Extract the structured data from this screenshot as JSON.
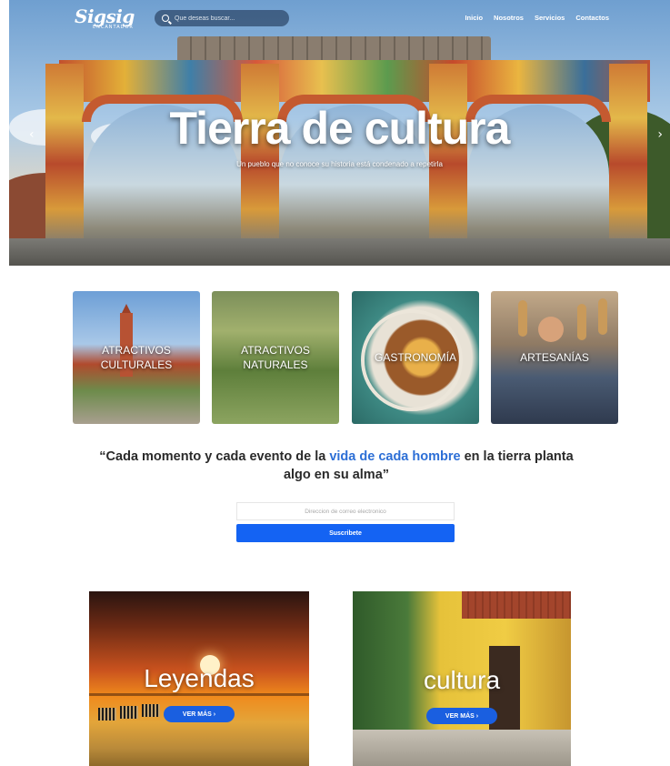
{
  "nav": {
    "logo": "Sigsig",
    "logo_sub": "ENCANTADOR",
    "search_placeholder": "Que deseas buscar...",
    "menu": [
      "Inicio",
      "Nosotros",
      "Servicios",
      "Contactos"
    ]
  },
  "hero": {
    "title": "Tierra de cultura",
    "subtitle": "Un pueblo que no conoce su historia está condenado a repetirla",
    "prev_arrow": "‹",
    "next_arrow": "›"
  },
  "categories": [
    {
      "label": "ATRACTIVOS CULTURALES"
    },
    {
      "label": "ATRACTIVOS NATURALES"
    },
    {
      "label": "GASTRONOMÍA"
    },
    {
      "label": "ARTESANÍAS"
    }
  ],
  "quote": {
    "part1": "“Cada momento y cada evento de la ",
    "highlight": "vida de cada hombre",
    "part2": " en la tierra planta algo en su alma”"
  },
  "subscribe": {
    "email_placeholder": "Direccion de correo electronico",
    "button": "Suscribete"
  },
  "tiles": [
    {
      "title": "Leyendas",
      "button": "VER MÁS  ›"
    },
    {
      "title": "cultura",
      "button": "VER MÁS  ›"
    }
  ],
  "colors": {
    "accent": "#1463f3",
    "quote_highlight": "#2d6fd6"
  }
}
